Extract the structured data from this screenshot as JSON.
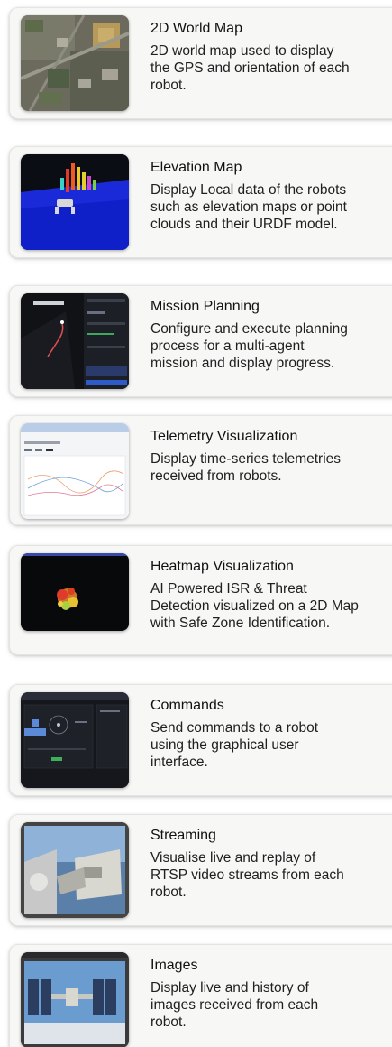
{
  "features": [
    {
      "title": "2D World Map",
      "description": [
        "2D world map used to display",
        "the GPS and orientation of each",
        "robot."
      ],
      "thumbnail_icon": "satellite-map-thumbnail"
    },
    {
      "title": "Elevation Map",
      "description": [
        "Display Local data of the robots",
        "such as elevation maps or point",
        "clouds and their URDF model."
      ],
      "thumbnail_icon": "elevation-map-thumbnail"
    },
    {
      "title": "Mission Planning",
      "description": [
        "Configure and execute planning",
        "process for a multi-agent",
        "mission and display progress."
      ],
      "thumbnail_icon": "mission-planner-thumbnail"
    },
    {
      "title": "Telemetry Visualization",
      "description": [
        "Display time-series telemetries",
        "received from robots."
      ],
      "thumbnail_icon": "telemetry-chart-thumbnail"
    },
    {
      "title": "Heatmap Visualization",
      "description": [
        "AI Powered ISR & Threat",
        "Detection visualized on a 2D Map",
        "with Safe Zone Identification."
      ],
      "thumbnail_icon": "heatmap-thumbnail"
    },
    {
      "title": "Commands",
      "description": [
        "Send commands to a robot",
        "using the graphical user",
        "interface."
      ],
      "thumbnail_icon": "command-panel-thumbnail"
    },
    {
      "title": "Streaming",
      "description": [
        "Visualise live and replay of",
        "RTSP video streams from each",
        "robot."
      ],
      "thumbnail_icon": "video-stream-thumbnail"
    },
    {
      "title": "Images",
      "description": [
        "Display live and history of",
        "images received from each",
        "robot."
      ],
      "thumbnail_icon": "image-gallery-thumbnail"
    }
  ]
}
